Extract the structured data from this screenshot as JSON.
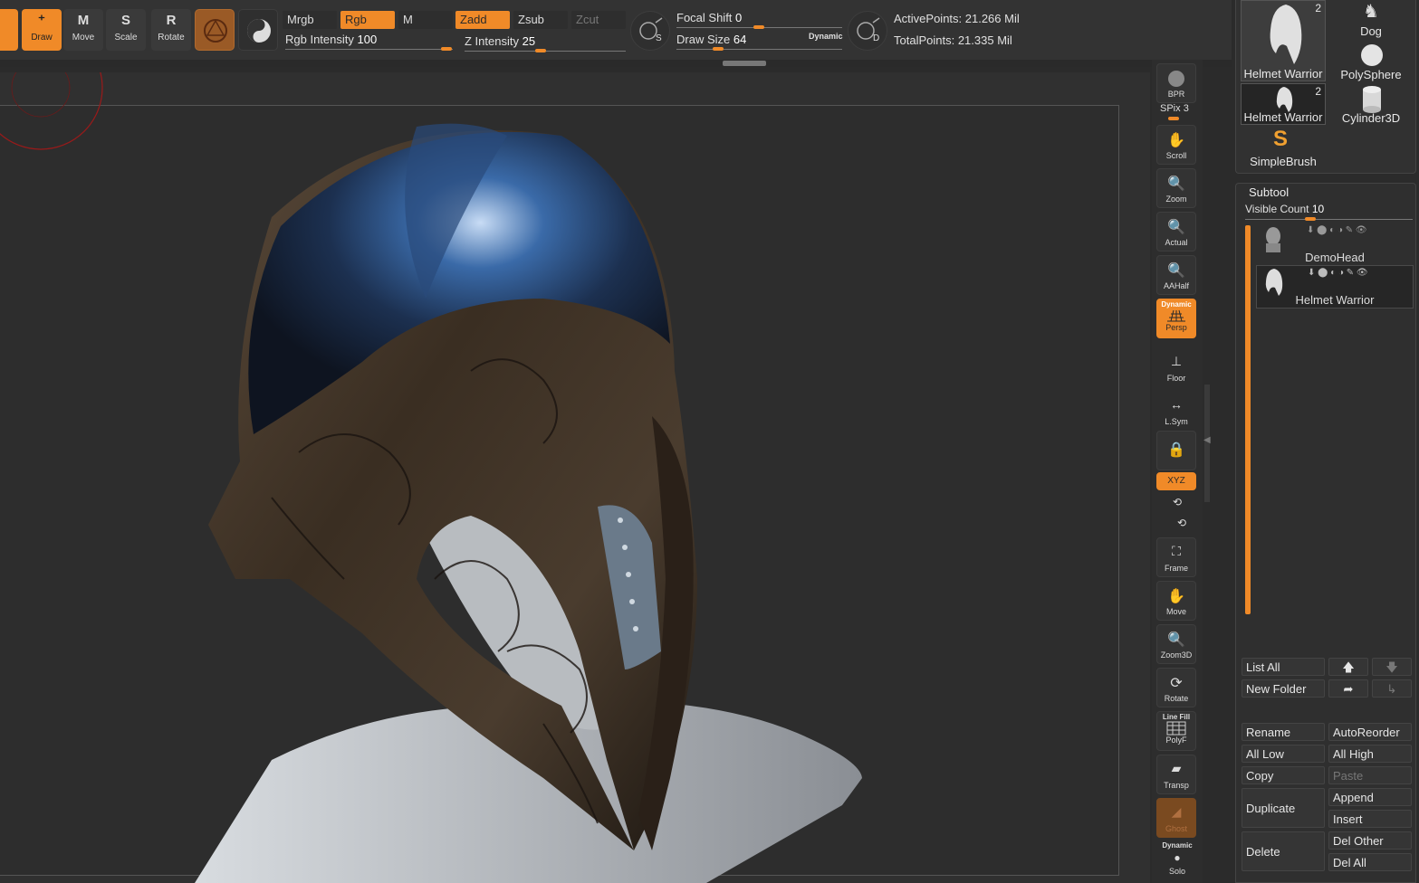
{
  "toolbar": {
    "modes": [
      {
        "label": "Draw",
        "glyph": "⁺"
      },
      {
        "label": "Move",
        "glyph": "M"
      },
      {
        "label": "Scale",
        "glyph": "S"
      },
      {
        "label": "Rotate",
        "glyph": "R"
      }
    ],
    "mrgb": "Mrgb",
    "rgb": "Rgb",
    "m": "M",
    "zadd": "Zadd",
    "zsub": "Zsub",
    "zcut": "Zcut",
    "rgb_intensity_label": "Rgb Intensity",
    "rgb_intensity_value": "100",
    "z_intensity_label": "Z Intensity",
    "z_intensity_value": "25",
    "focal_shift_label": "Focal Shift",
    "focal_shift_value": "0",
    "draw_size_label": "Draw Size",
    "draw_size_value": "64",
    "dynamic": "Dynamic",
    "active_points": "ActivePoints: 21.266 Mil",
    "total_points": "TotalPoints: 21.335 Mil",
    "s_label": "S",
    "d_label": "D"
  },
  "strip": {
    "bpr": "BPR",
    "spix_label": "SPix",
    "spix_value": "3",
    "scroll": "Scroll",
    "zoom": "Zoom",
    "actual": "Actual",
    "aahalf": "AAHalf",
    "dynamic": "Dynamic",
    "persp": "Persp",
    "floor": "Floor",
    "lsym": "L.Sym",
    "xyz": "XYZ",
    "frame": "Frame",
    "move": "Move",
    "zoom3d": "Zoom3D",
    "rotate": "Rotate",
    "linefill": "Line Fill",
    "polyf": "PolyF",
    "transp": "Transp",
    "ghost": "Ghost",
    "dynamic2": "Dynamic",
    "solo": "Solo"
  },
  "tools": [
    {
      "name": "Helmet Warrior",
      "count": "2"
    },
    {
      "name": "Dog",
      "count": ""
    },
    {
      "name": "PolySphere",
      "count": ""
    },
    {
      "name": "Helmet Warrior",
      "count": "2"
    },
    {
      "name": "Cylinder3D",
      "count": ""
    },
    {
      "name": "SimpleBrush",
      "count": ""
    }
  ],
  "subtool": {
    "title": "Subtool",
    "visible_count_label": "Visible Count",
    "visible_count_value": "10",
    "items": [
      {
        "name": "DemoHead"
      },
      {
        "name": "Helmet Warrior"
      }
    ],
    "buttons": {
      "list_all": "List All",
      "new_folder": "New Folder",
      "rename": "Rename",
      "autoreorder": "AutoReorder",
      "all_low": "All Low",
      "all_high": "All High",
      "copy": "Copy",
      "paste": "Paste",
      "duplicate": "Duplicate",
      "append": "Append",
      "insert": "Insert",
      "delete": "Delete",
      "del_other": "Del Other",
      "del_all": "Del All"
    }
  }
}
